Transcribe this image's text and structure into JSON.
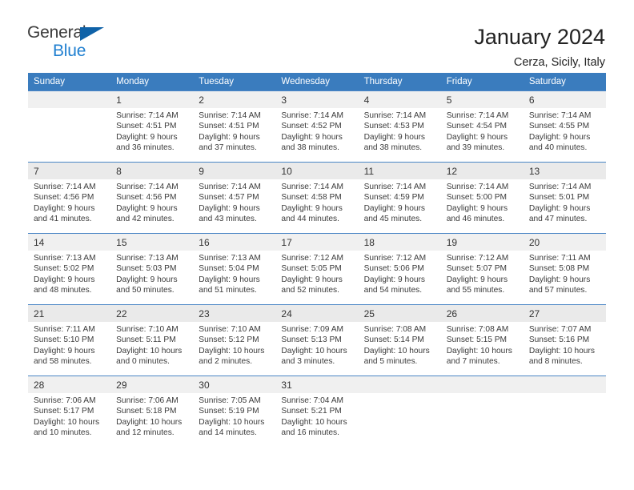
{
  "brand": {
    "name_part1": "General",
    "name_part2": "Blue",
    "triangle_icon": "triangle-icon",
    "accent_color": "#1f7fd0",
    "triangle_color": "#0f62a8"
  },
  "header": {
    "title": "January 2024",
    "location": "Cerza, Sicily, Italy"
  },
  "calendar": {
    "header_bg": "#3a7cbe",
    "row_band_colors": [
      "#f0f0f0",
      "#eaeaea"
    ],
    "weekdays": [
      "Sunday",
      "Monday",
      "Tuesday",
      "Wednesday",
      "Thursday",
      "Friday",
      "Saturday"
    ],
    "labels": {
      "sunrise": "Sunrise:",
      "sunset": "Sunset:",
      "daylight": "Daylight:"
    },
    "weeks": [
      [
        {
          "day": ""
        },
        {
          "day": "1",
          "sunrise": "Sunrise: 7:14 AM",
          "sunset": "Sunset: 4:51 PM",
          "daylight_line1": "Daylight: 9 hours",
          "daylight_line2": "and 36 minutes."
        },
        {
          "day": "2",
          "sunrise": "Sunrise: 7:14 AM",
          "sunset": "Sunset: 4:51 PM",
          "daylight_line1": "Daylight: 9 hours",
          "daylight_line2": "and 37 minutes."
        },
        {
          "day": "3",
          "sunrise": "Sunrise: 7:14 AM",
          "sunset": "Sunset: 4:52 PM",
          "daylight_line1": "Daylight: 9 hours",
          "daylight_line2": "and 38 minutes."
        },
        {
          "day": "4",
          "sunrise": "Sunrise: 7:14 AM",
          "sunset": "Sunset: 4:53 PM",
          "daylight_line1": "Daylight: 9 hours",
          "daylight_line2": "and 38 minutes."
        },
        {
          "day": "5",
          "sunrise": "Sunrise: 7:14 AM",
          "sunset": "Sunset: 4:54 PM",
          "daylight_line1": "Daylight: 9 hours",
          "daylight_line2": "and 39 minutes."
        },
        {
          "day": "6",
          "sunrise": "Sunrise: 7:14 AM",
          "sunset": "Sunset: 4:55 PM",
          "daylight_line1": "Daylight: 9 hours",
          "daylight_line2": "and 40 minutes."
        }
      ],
      [
        {
          "day": "7",
          "sunrise": "Sunrise: 7:14 AM",
          "sunset": "Sunset: 4:56 PM",
          "daylight_line1": "Daylight: 9 hours",
          "daylight_line2": "and 41 minutes."
        },
        {
          "day": "8",
          "sunrise": "Sunrise: 7:14 AM",
          "sunset": "Sunset: 4:56 PM",
          "daylight_line1": "Daylight: 9 hours",
          "daylight_line2": "and 42 minutes."
        },
        {
          "day": "9",
          "sunrise": "Sunrise: 7:14 AM",
          "sunset": "Sunset: 4:57 PM",
          "daylight_line1": "Daylight: 9 hours",
          "daylight_line2": "and 43 minutes."
        },
        {
          "day": "10",
          "sunrise": "Sunrise: 7:14 AM",
          "sunset": "Sunset: 4:58 PM",
          "daylight_line1": "Daylight: 9 hours",
          "daylight_line2": "and 44 minutes."
        },
        {
          "day": "11",
          "sunrise": "Sunrise: 7:14 AM",
          "sunset": "Sunset: 4:59 PM",
          "daylight_line1": "Daylight: 9 hours",
          "daylight_line2": "and 45 minutes."
        },
        {
          "day": "12",
          "sunrise": "Sunrise: 7:14 AM",
          "sunset": "Sunset: 5:00 PM",
          "daylight_line1": "Daylight: 9 hours",
          "daylight_line2": "and 46 minutes."
        },
        {
          "day": "13",
          "sunrise": "Sunrise: 7:14 AM",
          "sunset": "Sunset: 5:01 PM",
          "daylight_line1": "Daylight: 9 hours",
          "daylight_line2": "and 47 minutes."
        }
      ],
      [
        {
          "day": "14",
          "sunrise": "Sunrise: 7:13 AM",
          "sunset": "Sunset: 5:02 PM",
          "daylight_line1": "Daylight: 9 hours",
          "daylight_line2": "and 48 minutes."
        },
        {
          "day": "15",
          "sunrise": "Sunrise: 7:13 AM",
          "sunset": "Sunset: 5:03 PM",
          "daylight_line1": "Daylight: 9 hours",
          "daylight_line2": "and 50 minutes."
        },
        {
          "day": "16",
          "sunrise": "Sunrise: 7:13 AM",
          "sunset": "Sunset: 5:04 PM",
          "daylight_line1": "Daylight: 9 hours",
          "daylight_line2": "and 51 minutes."
        },
        {
          "day": "17",
          "sunrise": "Sunrise: 7:12 AM",
          "sunset": "Sunset: 5:05 PM",
          "daylight_line1": "Daylight: 9 hours",
          "daylight_line2": "and 52 minutes."
        },
        {
          "day": "18",
          "sunrise": "Sunrise: 7:12 AM",
          "sunset": "Sunset: 5:06 PM",
          "daylight_line1": "Daylight: 9 hours",
          "daylight_line2": "and 54 minutes."
        },
        {
          "day": "19",
          "sunrise": "Sunrise: 7:12 AM",
          "sunset": "Sunset: 5:07 PM",
          "daylight_line1": "Daylight: 9 hours",
          "daylight_line2": "and 55 minutes."
        },
        {
          "day": "20",
          "sunrise": "Sunrise: 7:11 AM",
          "sunset": "Sunset: 5:08 PM",
          "daylight_line1": "Daylight: 9 hours",
          "daylight_line2": "and 57 minutes."
        }
      ],
      [
        {
          "day": "21",
          "sunrise": "Sunrise: 7:11 AM",
          "sunset": "Sunset: 5:10 PM",
          "daylight_line1": "Daylight: 9 hours",
          "daylight_line2": "and 58 minutes."
        },
        {
          "day": "22",
          "sunrise": "Sunrise: 7:10 AM",
          "sunset": "Sunset: 5:11 PM",
          "daylight_line1": "Daylight: 10 hours",
          "daylight_line2": "and 0 minutes."
        },
        {
          "day": "23",
          "sunrise": "Sunrise: 7:10 AM",
          "sunset": "Sunset: 5:12 PM",
          "daylight_line1": "Daylight: 10 hours",
          "daylight_line2": "and 2 minutes."
        },
        {
          "day": "24",
          "sunrise": "Sunrise: 7:09 AM",
          "sunset": "Sunset: 5:13 PM",
          "daylight_line1": "Daylight: 10 hours",
          "daylight_line2": "and 3 minutes."
        },
        {
          "day": "25",
          "sunrise": "Sunrise: 7:08 AM",
          "sunset": "Sunset: 5:14 PM",
          "daylight_line1": "Daylight: 10 hours",
          "daylight_line2": "and 5 minutes."
        },
        {
          "day": "26",
          "sunrise": "Sunrise: 7:08 AM",
          "sunset": "Sunset: 5:15 PM",
          "daylight_line1": "Daylight: 10 hours",
          "daylight_line2": "and 7 minutes."
        },
        {
          "day": "27",
          "sunrise": "Sunrise: 7:07 AM",
          "sunset": "Sunset: 5:16 PM",
          "daylight_line1": "Daylight: 10 hours",
          "daylight_line2": "and 8 minutes."
        }
      ],
      [
        {
          "day": "28",
          "sunrise": "Sunrise: 7:06 AM",
          "sunset": "Sunset: 5:17 PM",
          "daylight_line1": "Daylight: 10 hours",
          "daylight_line2": "and 10 minutes."
        },
        {
          "day": "29",
          "sunrise": "Sunrise: 7:06 AM",
          "sunset": "Sunset: 5:18 PM",
          "daylight_line1": "Daylight: 10 hours",
          "daylight_line2": "and 12 minutes."
        },
        {
          "day": "30",
          "sunrise": "Sunrise: 7:05 AM",
          "sunset": "Sunset: 5:19 PM",
          "daylight_line1": "Daylight: 10 hours",
          "daylight_line2": "and 14 minutes."
        },
        {
          "day": "31",
          "sunrise": "Sunrise: 7:04 AM",
          "sunset": "Sunset: 5:21 PM",
          "daylight_line1": "Daylight: 10 hours",
          "daylight_line2": "and 16 minutes."
        },
        {
          "day": ""
        },
        {
          "day": ""
        },
        {
          "day": ""
        }
      ]
    ]
  }
}
